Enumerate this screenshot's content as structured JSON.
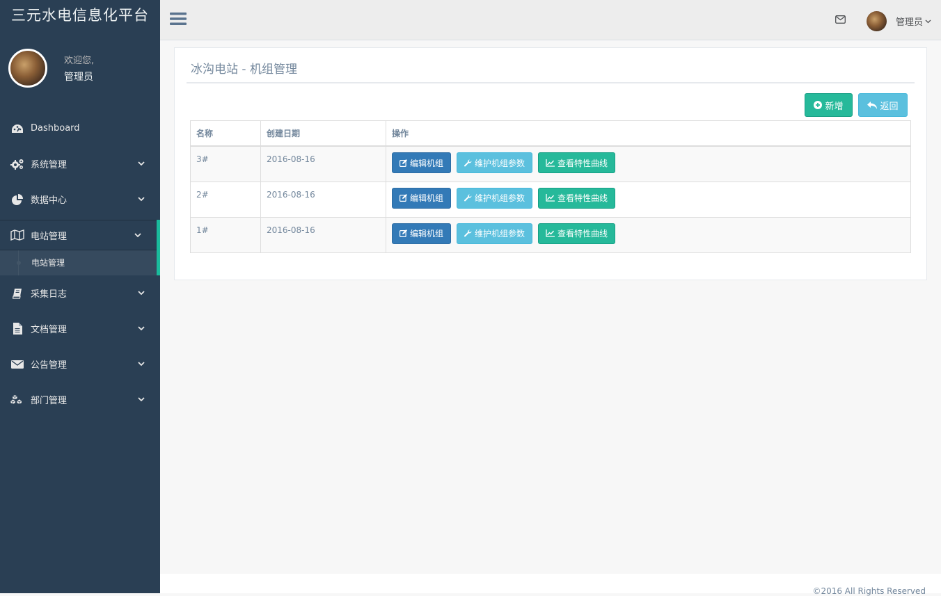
{
  "brand": "三元水电信息化平台",
  "profile": {
    "welcome": "欢迎您,",
    "name": "管理员"
  },
  "menu": [
    {
      "label": "Dashboard",
      "icon": "dashboard-icon"
    },
    {
      "label": "系统管理",
      "icon": "cogs-icon"
    },
    {
      "label": "数据中心",
      "icon": "pie-chart-icon"
    },
    {
      "label": "电站管理",
      "icon": "map-icon"
    },
    {
      "label": "采集日志",
      "icon": "book-icon"
    },
    {
      "label": "文档管理",
      "icon": "file-icon"
    },
    {
      "label": "公告管理",
      "icon": "envelope-icon"
    },
    {
      "label": "部门管理",
      "icon": "cubes-icon"
    }
  ],
  "submenu": {
    "label": "电站管理"
  },
  "topnav": {
    "user": "管理员"
  },
  "panel": {
    "title": "冰沟电站 - 机组管理",
    "add_label": "新增",
    "back_label": "返回"
  },
  "table": {
    "headers": [
      "名称",
      "创建日期",
      "操作"
    ],
    "rows": [
      {
        "name": "3#",
        "date": "2016-08-16"
      },
      {
        "name": "2#",
        "date": "2016-08-16"
      },
      {
        "name": "1#",
        "date": "2016-08-16"
      }
    ],
    "actions": {
      "edit": "编辑机组",
      "maint": "维护机组参数",
      "curve": "查看特性曲线"
    }
  },
  "footer": "©2016 All Rights Reserved"
}
